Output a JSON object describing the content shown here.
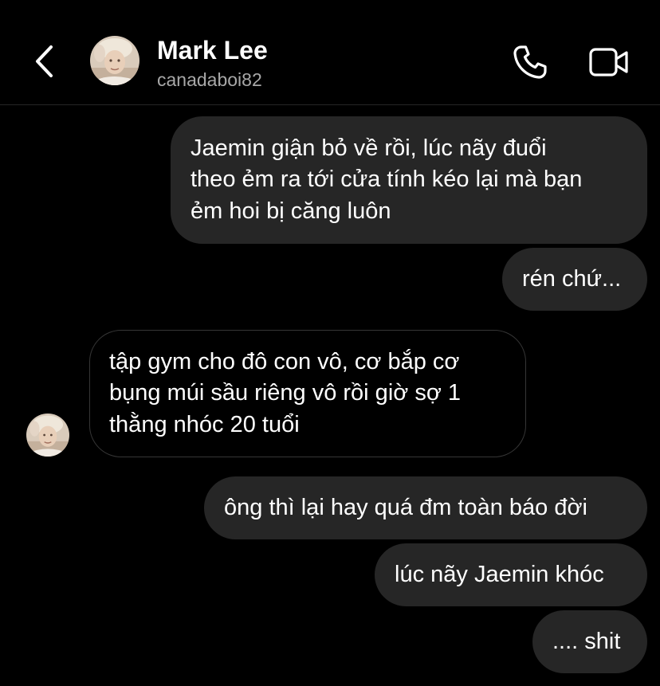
{
  "header": {
    "name": "Mark Lee",
    "username": "canadaboi82"
  },
  "messages": [
    {
      "side": "sent",
      "text": "Jaemin giận bỏ về rồi, lúc nãy đuổi\ntheo ẻm ra tới cửa tính kéo lại mà bạn\nẻm hoi bị căng luôn"
    },
    {
      "side": "sent",
      "text": "rén chứ..."
    },
    {
      "side": "received",
      "text": "tập gym cho đô con vô, cơ bắp cơ\nbụng múi sầu riêng vô rồi giờ sợ 1\nthằng nhóc 20 tuổi"
    },
    {
      "side": "sent",
      "text": "ông thì lại hay quá đm toàn báo đời"
    },
    {
      "side": "sent",
      "text": "lúc nãy Jaemin khóc"
    },
    {
      "side": "sent",
      "text": ".... shit"
    }
  ],
  "icons": {
    "back": "chevron-left-icon",
    "call": "phone-icon",
    "video": "video-camera-icon",
    "avatar": "profile-photo"
  },
  "colors": {
    "background": "#000000",
    "sent_bubble": "#262626",
    "received_bubble_border": "#363636",
    "secondary_text": "#a8a8a8",
    "avatar_tone": "#d8c7b6"
  }
}
